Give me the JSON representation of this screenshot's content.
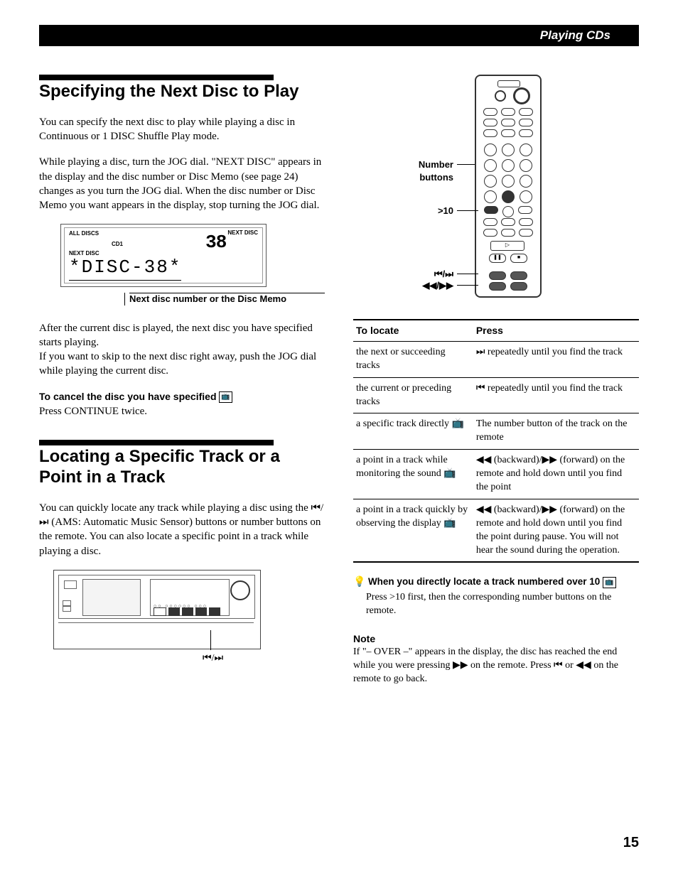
{
  "header": {
    "title": "Playing CDs"
  },
  "section1": {
    "title": "Specifying the Next Disc to Play",
    "para1": "You can specify the next disc to play while playing a disc in Continuous or 1 DISC Shuffle Play mode.",
    "para2": "While playing a disc, turn the JOG dial. \"NEXT DISC\" appears in the display and the disc number or Disc Memo (see page 24) changes as you turn the JOG dial. When the disc number or Disc Memo you want appears in the display, stop turning the JOG dial.",
    "display": {
      "all_discs": "ALL DISCS",
      "cd1": "CD1",
      "big_num": "38",
      "next_disc_small": "NEXT DISC",
      "next_disc_label": "NEXT DISC",
      "main": "*DISC-38*",
      "caption": "Next disc number or the Disc Memo"
    },
    "para3": "After the current disc is played, the next disc you have specified starts playing.",
    "para4": "If you want to skip to the next disc right away, push the JOG dial while playing the current disc.",
    "cancel_head": "To cancel the disc you have specified",
    "cancel_body": "Press CONTINUE twice."
  },
  "section2": {
    "title": "Locating a Specific Track or a Point in a Track",
    "para1": "You can quickly locate any track while playing a disc using the ⏮/⏭ (AMS: Automatic Music Sensor) buttons or number buttons on the remote. You can also locate a specific point in a track while playing a disc.",
    "unit_caption": "⏮/⏭"
  },
  "remote": {
    "label_number": "Number buttons",
    "label_gt10": ">10",
    "label_skip": "⏮/⏭",
    "label_scan": "◀◀/▶▶"
  },
  "table": {
    "h1": "To locate",
    "h2": "Press",
    "rows": [
      {
        "c1": "the next or succeeding tracks",
        "c2": "⏭ repeatedly until you find the track"
      },
      {
        "c1": "the current or preceding tracks",
        "c2": "⏮ repeatedly until you find the track"
      },
      {
        "c1": "a specific track directly 📺",
        "c2": "The number button of the track on the remote"
      },
      {
        "c1": "a point in a track while monitoring the sound 📺",
        "c2": "◀◀ (backward)/▶▶ (forward) on the remote and hold down until you find the point"
      },
      {
        "c1": "a point in a track quickly by observing the display 📺",
        "c2": "◀◀ (backward)/▶▶ (forward) on the remote and hold down until you find the point during pause. You will not hear the sound during the operation."
      }
    ]
  },
  "tip": {
    "head": "When you directly locate a track numbered over 10",
    "body": "Press >10 first, then the corresponding number buttons on the remote."
  },
  "note": {
    "head": "Note",
    "body": "If \"– OVER –\" appears in the display, the disc has reached the end while you were pressing ▶▶ on the remote. Press ⏮ or ◀◀ on the remote to go back."
  },
  "page_number": "15"
}
